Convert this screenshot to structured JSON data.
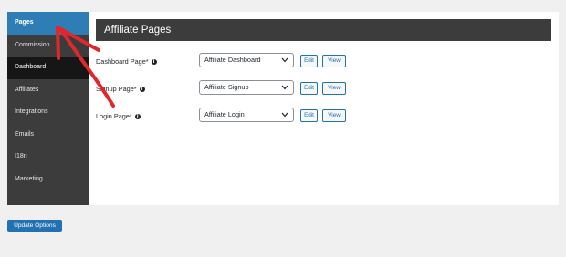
{
  "sidebar": {
    "items": [
      {
        "label": "Pages"
      },
      {
        "label": "Commission"
      },
      {
        "label": "Dashboard"
      },
      {
        "label": "Affiliates"
      },
      {
        "label": "Integrations"
      },
      {
        "label": "Emails"
      },
      {
        "label": "I18n"
      },
      {
        "label": "Marketing"
      }
    ]
  },
  "main": {
    "title": "Affiliate Pages",
    "rows": [
      {
        "label": "Dashboard Page*",
        "selected": "Affiliate Dashboard",
        "edit": "Edit",
        "view": "View"
      },
      {
        "label": "Signup Page*",
        "selected": "Affiliate Signup",
        "edit": "Edit",
        "view": "View"
      },
      {
        "label": "Login Page*",
        "selected": "Affiliate Login",
        "edit": "Edit",
        "view": "View"
      }
    ]
  },
  "footer": {
    "update_label": "Update Options"
  },
  "colors": {
    "accent": "#2271b1",
    "sidebar": "#3c3c3c",
    "annotation": "#e0272b"
  }
}
